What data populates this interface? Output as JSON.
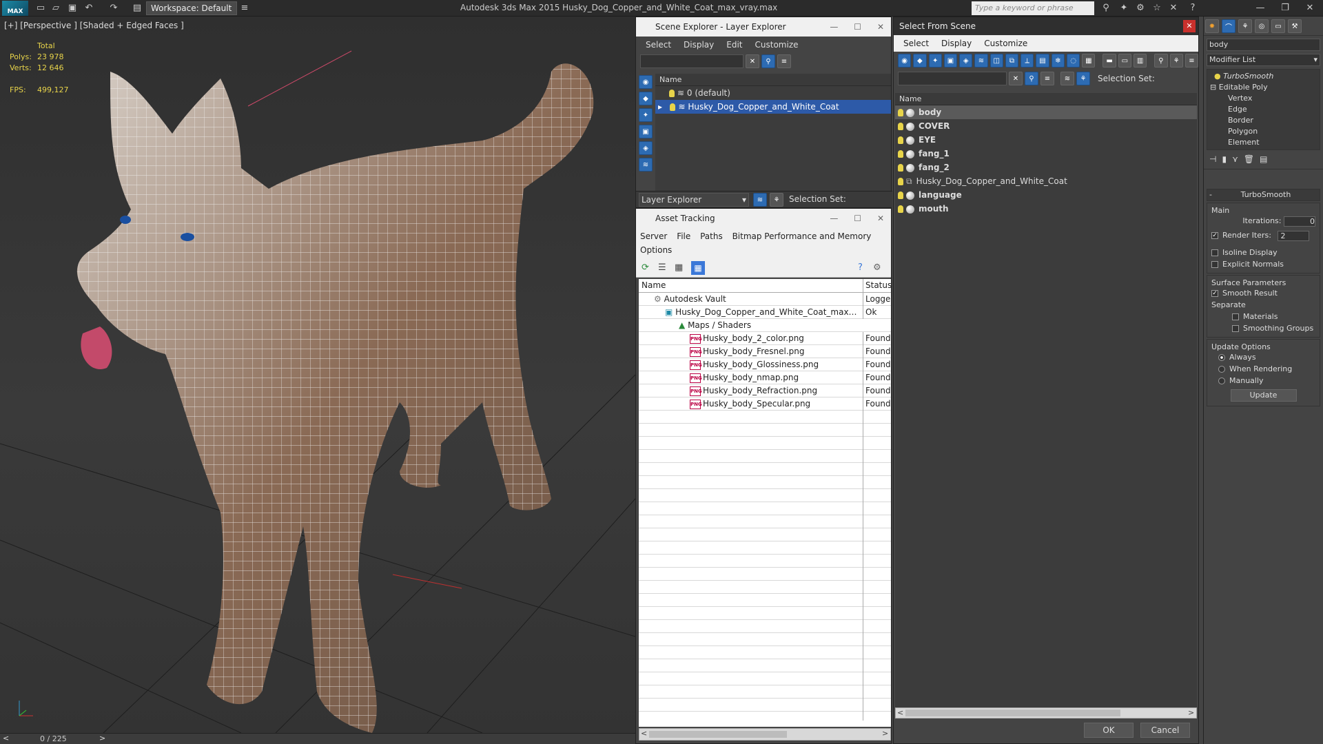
{
  "app": {
    "title": "Autodesk 3ds Max  2015    Husky_Dog_Copper_and_White_Coat_max_vray.max",
    "logo": "MAX",
    "workspace": "Workspace: Default",
    "search_placeholder": "Type a keyword or phrase"
  },
  "viewport": {
    "label": "[+] [Perspective ] [Shaded + Edged Faces ]",
    "stats": {
      "total_label": "Total",
      "polys_label": "Polys:",
      "polys": "23 978",
      "verts_label": "Verts:",
      "verts": "12 646",
      "fps_label": "FPS:",
      "fps": "499,127"
    },
    "timeline": "0 / 225"
  },
  "layer_explorer": {
    "title": "Scene Explorer - Layer Explorer",
    "menu": [
      "Select",
      "Display",
      "Edit",
      "Customize"
    ],
    "column": "Name",
    "rows": [
      "0 (default)",
      "Husky_Dog_Copper_and_White_Coat"
    ],
    "footer_dropdown": "Layer Explorer",
    "selection_set": "Selection Set:"
  },
  "asset_tracking": {
    "title": "Asset Tracking",
    "menu": [
      "Server",
      "File",
      "Paths",
      "Bitmap Performance and Memory"
    ],
    "menu2": "Options",
    "col_name": "Name",
    "col_status": "Status",
    "rows": [
      {
        "name": "Autodesk Vault",
        "status": "Logged"
      },
      {
        "name": "Husky_Dog_Copper_and_White_Coat_max_vray.max",
        "status": "Ok"
      },
      {
        "name": "Maps / Shaders",
        "status": ""
      },
      {
        "name": "Husky_body_2_color.png",
        "status": "Found"
      },
      {
        "name": "Husky_body_Fresnel.png",
        "status": "Found"
      },
      {
        "name": "Husky_body_Glossiness.png",
        "status": "Found"
      },
      {
        "name": "Husky_body_nmap.png",
        "status": "Found"
      },
      {
        "name": "Husky_body_Refraction.png",
        "status": "Found"
      },
      {
        "name": "Husky_body_Specular.png",
        "status": "Found"
      }
    ]
  },
  "select_from_scene": {
    "title": "Select From Scene",
    "menu": [
      "Select",
      "Display",
      "Customize"
    ],
    "selection_set": "Selection Set:",
    "column": "Name",
    "rows": [
      "body",
      "COVER",
      "EYE",
      "fang_1",
      "fang_2",
      "Husky_Dog_Copper_and_White_Coat",
      "language",
      "mouth"
    ],
    "ok": "OK",
    "cancel": "Cancel"
  },
  "command_panel": {
    "object_name": "body",
    "modifier_list": "Modifier List",
    "stack": [
      "TurboSmooth",
      "Editable Poly",
      "Vertex",
      "Edge",
      "Border",
      "Polygon",
      "Element"
    ],
    "rollout_title": "TurboSmooth",
    "main": "Main",
    "iterations_label": "Iterations:",
    "iterations": "0",
    "render_iters_label": "Render Iters:",
    "render_iters": "2",
    "isoline": "Isoline Display",
    "explicit": "Explicit Normals",
    "surface": "Surface Parameters",
    "smooth": "Smooth Result",
    "separate": "Separate",
    "materials": "Materials",
    "smoothing": "Smoothing Groups",
    "update_options": "Update Options",
    "always": "Always",
    "when_rendering": "When Rendering",
    "manually": "Manually",
    "update": "Update"
  }
}
